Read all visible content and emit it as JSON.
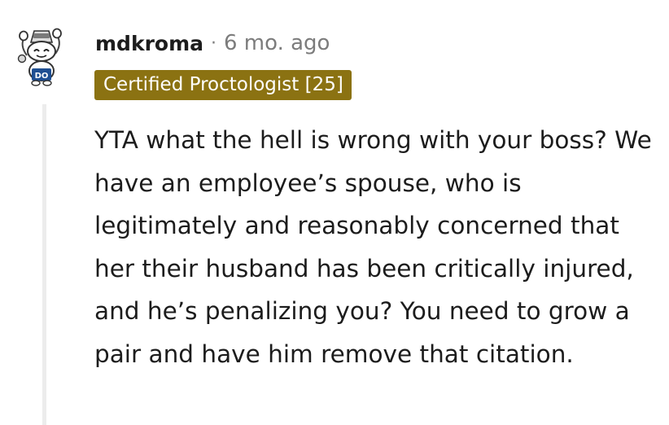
{
  "comment": {
    "username": "mdkroma",
    "separator": "·",
    "timestamp": "6 mo. ago",
    "flair": "Certified Proctologist [25]",
    "body": "YTA what the hell is wrong with your boss? We have an employee’s spouse, who is legitimately and reasonably concerned that her their husband has been critically injured, and he’s penalizing you? You need to grow a pair and have him remove that citation.",
    "avatar_text": "DO"
  },
  "colors": {
    "flair_background": "#8b7212",
    "flair_text": "#ffffff",
    "username": "#1c1c1c",
    "meta": "#7c7c7c",
    "thread_line": "#ececec",
    "avatar_badge": "#1f4f92"
  },
  "icons": {
    "avatar": "snoo-avatar-icon"
  }
}
